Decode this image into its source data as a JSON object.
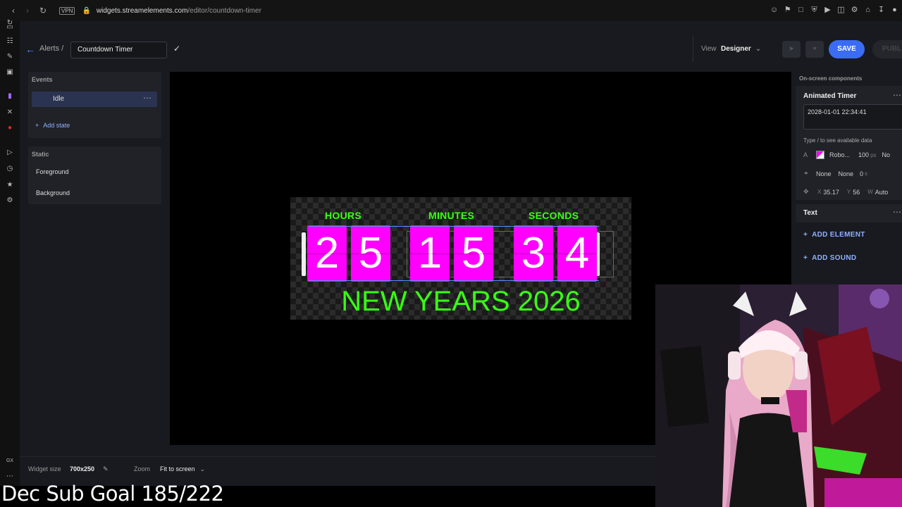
{
  "browser": {
    "vpn_badge": "VPN",
    "url_domain": "widgets.streamelements.com",
    "url_path": "/editor/countdown-timer"
  },
  "header": {
    "breadcrumb": "Alerts /",
    "widget_name": "Countdown Timer",
    "view_label": "View",
    "view_value": "Designer",
    "save_label": "SAVE",
    "publish_label": "PUBL"
  },
  "events_panel": {
    "heading": "Events",
    "state": "Idle",
    "add_state": "Add state"
  },
  "static_panel": {
    "heading": "Static",
    "items": [
      "Foreground",
      "Background"
    ]
  },
  "widget": {
    "units": [
      "HOURS",
      "MINUTES",
      "SECONDS"
    ],
    "digits": [
      "2",
      "5",
      "1",
      "5",
      "3",
      "4"
    ],
    "event_title": "NEW YEARS 2026",
    "accent_color": "#39ff14",
    "card_color": "#ff00ff"
  },
  "right_panel": {
    "heading": "On-screen components",
    "component_title": "Animated Timer",
    "date_value": "2028-01-01 22:34:41",
    "hint": "Type / to see available data",
    "font_name": "Robo...",
    "font_size": "100",
    "font_unit": "px",
    "font_extra": "No",
    "anim_in": "None",
    "anim_out": "None",
    "anim_duration": "0",
    "anim_duration_unit": "s",
    "pos_x_label": "X",
    "pos_x": "35.17",
    "pos_y_label": "Y",
    "pos_y": "56",
    "width_label": "W",
    "width": "Auto",
    "text_component": "Text",
    "add_element": "ADD ELEMENT",
    "add_sound": "ADD SOUND"
  },
  "bottom_bar": {
    "widget_size_label": "Widget size",
    "widget_size": "700x250",
    "zoom_label": "Zoom",
    "zoom_value": "Fit to screen"
  },
  "stream_overlay": {
    "sub_goal": "Dec Sub Goal 185/222"
  }
}
